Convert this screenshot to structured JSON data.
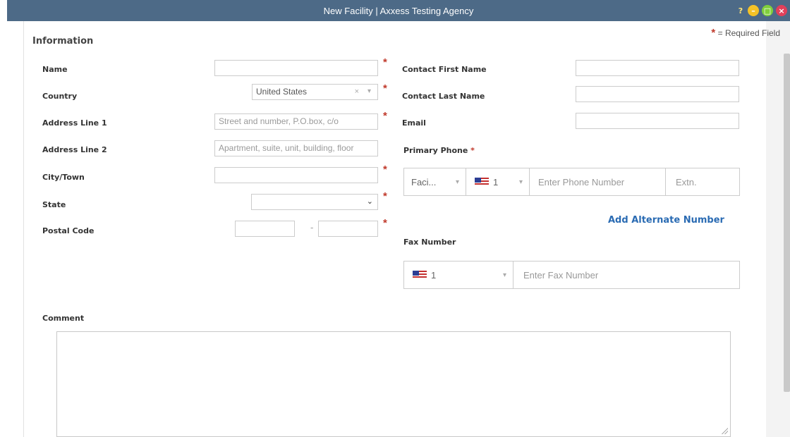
{
  "window": {
    "title": "New Facility | Axxess Testing Agency",
    "help_label": "?",
    "help_icon": "help-icon",
    "minimize_icon": "minimize-icon",
    "maximize_icon": "maximize-icon",
    "close_icon": "close-icon"
  },
  "legend": {
    "star": "*",
    "text": "= Required Field"
  },
  "section": {
    "title": "Information"
  },
  "left": {
    "name": {
      "label": "Name",
      "value": ""
    },
    "country": {
      "label": "Country",
      "value": "United States",
      "clear": "×",
      "caret": "▾"
    },
    "address1": {
      "label": "Address Line 1",
      "placeholder": "Street and number, P.O.box, c/o"
    },
    "address2": {
      "label": "Address Line 2",
      "placeholder": "Apartment, suite, unit, building, floor"
    },
    "city": {
      "label": "City/Town",
      "value": ""
    },
    "state": {
      "label": "State",
      "value": "",
      "caret": "⌄"
    },
    "postal": {
      "label": "Postal Code",
      "separator": "-"
    }
  },
  "right": {
    "contact_first": {
      "label": "Contact First Name"
    },
    "contact_last": {
      "label": "Contact Last Name"
    },
    "email": {
      "label": "Email"
    },
    "primary_phone": {
      "label": "Primary Phone",
      "star": "*",
      "type_value": "Faci...",
      "country_code": "1",
      "caret": "▾",
      "placeholder": "Enter Phone Number",
      "ext_placeholder": "Extn."
    },
    "add_alternate": "Add Alternate Number",
    "fax": {
      "label": "Fax Number",
      "country_code": "1",
      "caret": "▾",
      "placeholder": "Enter Fax Number"
    }
  },
  "comment": {
    "label": "Comment",
    "value": ""
  },
  "required_star": "*",
  "colors": {
    "titlebar": "#4d6a87",
    "required": "#c0392b",
    "link": "#2a6bb3"
  }
}
